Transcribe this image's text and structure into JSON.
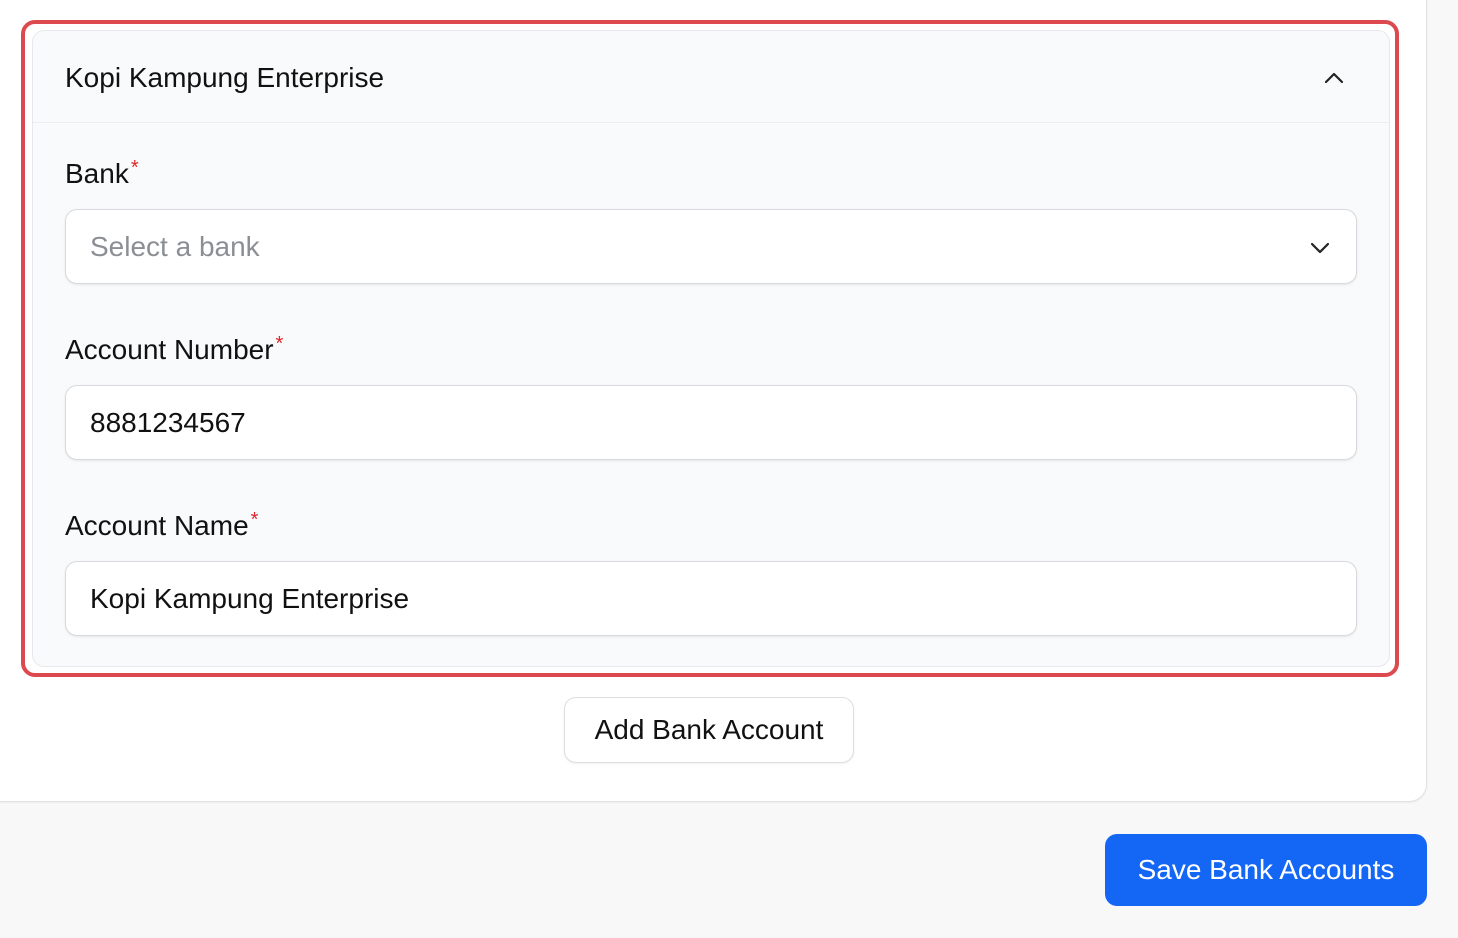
{
  "account_panel": {
    "title": "Kopi Kampung Enterprise",
    "collapse_icon": "chevron-up-icon"
  },
  "bank_field": {
    "label": "Bank",
    "required_mark": "*",
    "placeholder": "Select a bank",
    "dropdown_icon": "chevron-down-icon"
  },
  "account_number_field": {
    "label": "Account Number",
    "required_mark": "*",
    "value": "8881234567"
  },
  "account_name_field": {
    "label": "Account Name",
    "required_mark": "*",
    "value": "Kopi Kampung Enterprise"
  },
  "actions": {
    "add_label": "Add Bank Account",
    "save_label": "Save Bank Accounts"
  },
  "colors": {
    "highlight_border": "#dc4a4f",
    "required_mark": "#e0242a",
    "primary_button": "#1466f5"
  }
}
